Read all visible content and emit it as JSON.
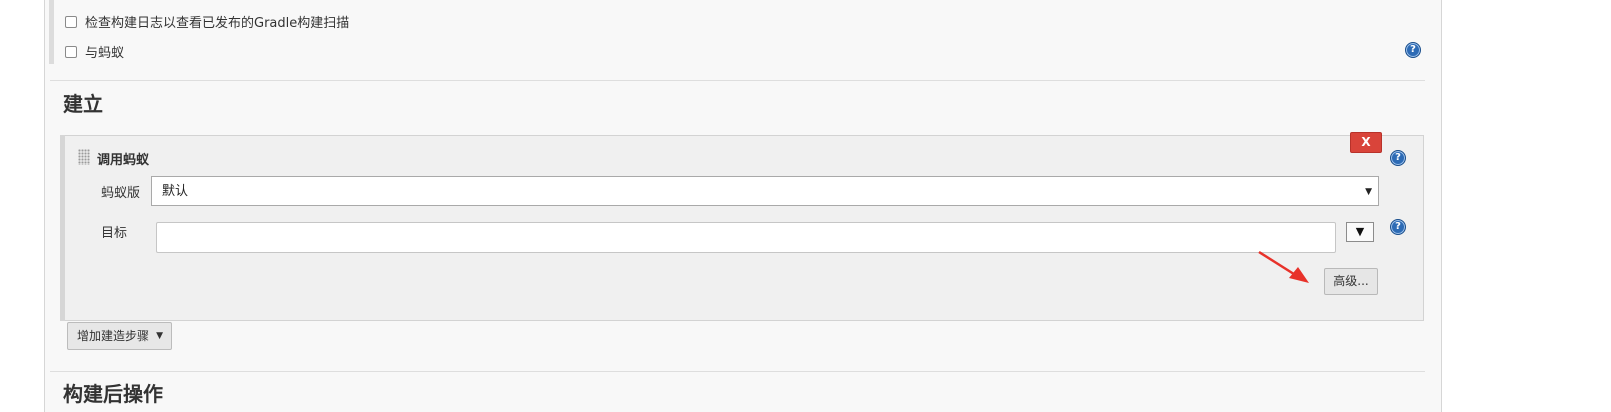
{
  "options": {
    "gradle_scan_label": "检查构建日志以查看已发布的Gradle构建扫描",
    "with_ant_label": "与蚂蚁"
  },
  "help_icon": "?",
  "build": {
    "section_title": "建立",
    "step": {
      "title": "调用蚂蚁",
      "delete_label": "X",
      "ant_version_label": "蚂蚁版",
      "ant_version_value": "默认",
      "targets_label": "目标",
      "targets_value": "",
      "expand_label": "▼",
      "advanced_label": "高级..."
    },
    "add_step_label": "增加建造步骤"
  },
  "post_build": {
    "section_title": "构建后操作"
  },
  "colors": {
    "delete_red": "#d9443a",
    "help_blue": "#2d6bb5",
    "arrow_red": "#e8322a"
  },
  "icons": [
    "checkbox-icon",
    "help-icon",
    "drag-handle-icon",
    "dropdown-caret-icon",
    "annotation-arrow-icon"
  ]
}
